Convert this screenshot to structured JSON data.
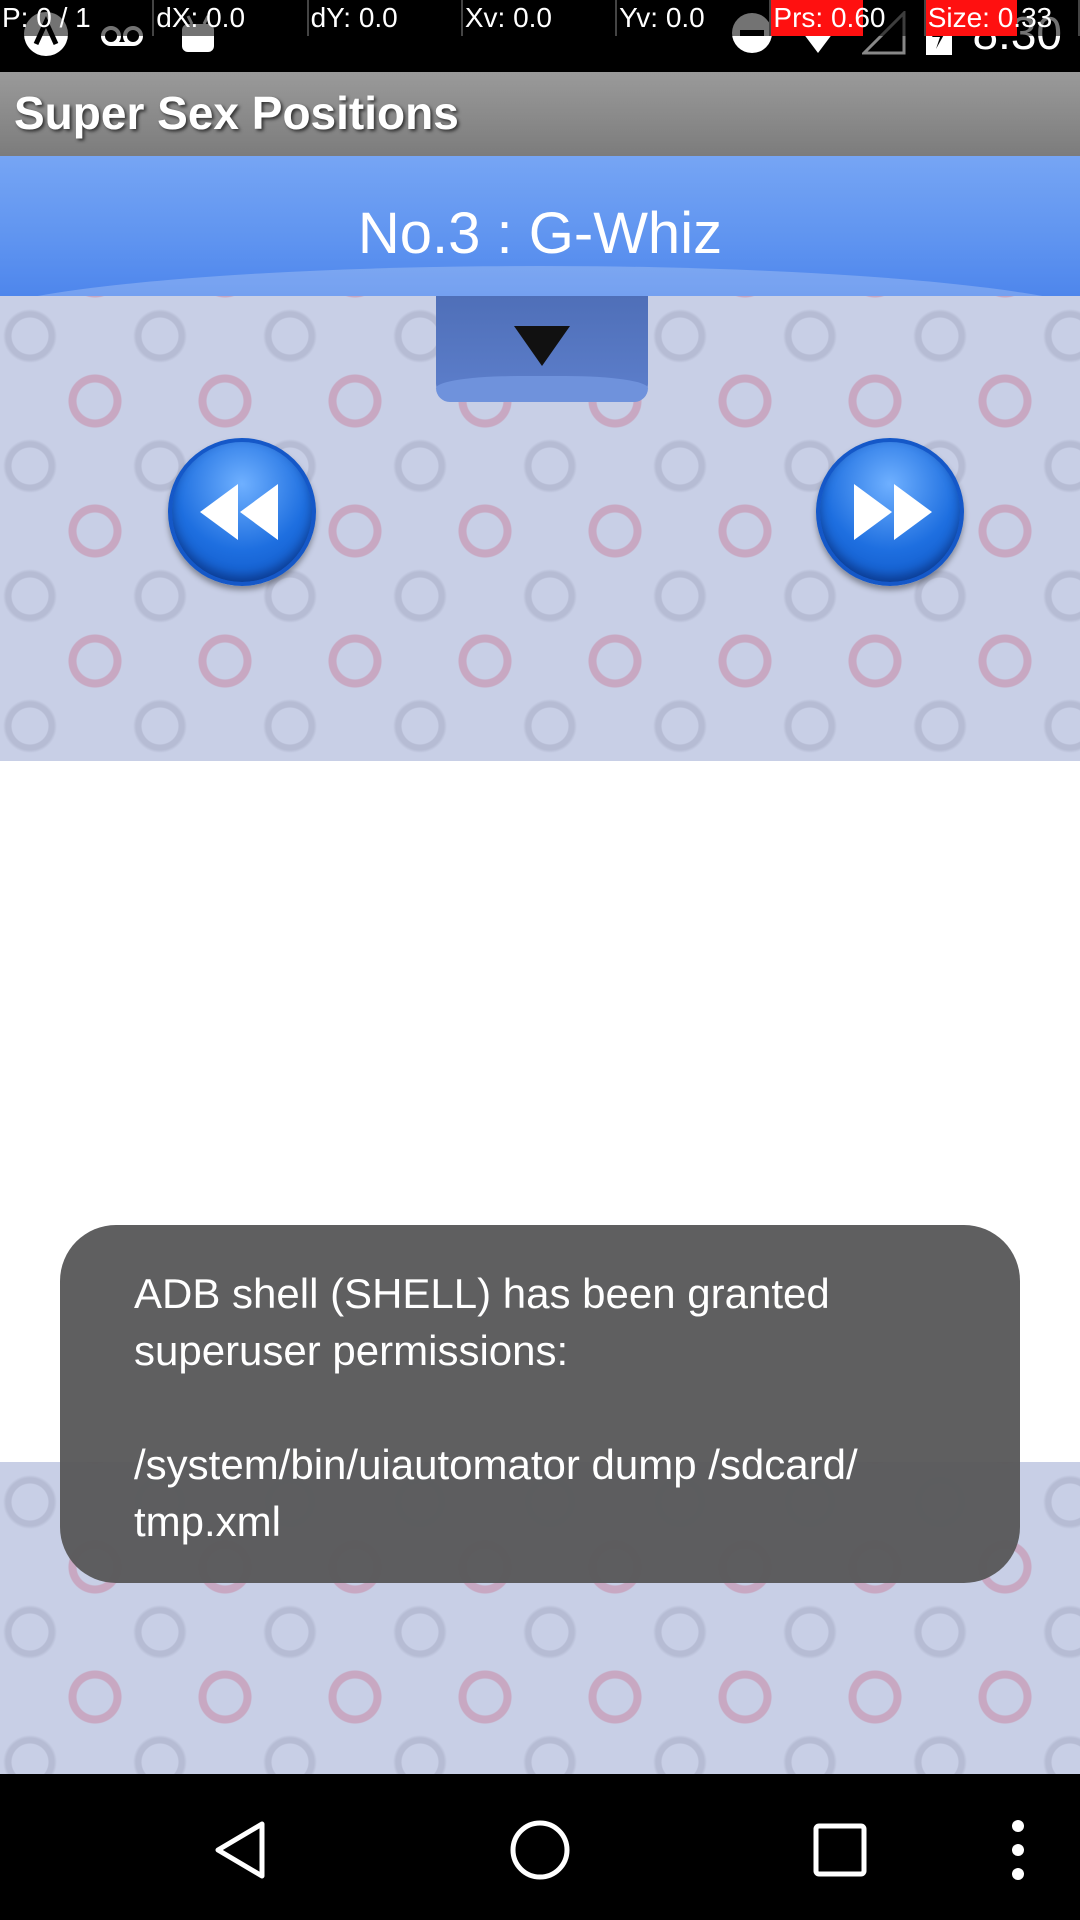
{
  "status_bar": {
    "pointer_overlay": [
      "P: 0 / 1",
      "dX: 0.0",
      "dY: 0.0",
      "Xv: 0.0",
      "Yv: 0.0",
      "Prs: 0.60",
      "Size: 0.33"
    ],
    "time": "8:30",
    "icons_left": [
      "app-icon",
      "voicemail-icon",
      "android-icon"
    ],
    "icons_right": [
      "do-not-disturb-icon",
      "wifi-icon",
      "signal-icon",
      "battery-icon"
    ]
  },
  "action_bar": {
    "title": "Super Sex Positions"
  },
  "banner": {
    "title": "No.3 : G-Whiz"
  },
  "controls": {
    "dropdown_icon": "triangle-down-icon",
    "prev_icon": "rewind-icon",
    "next_icon": "fast-forward-icon"
  },
  "toast": {
    "message": "ADB shell (SHELL) has been granted\nsuperuser permissions:\n\n/system/bin/uiautomator dump /sdcard/\ntmp.xml"
  },
  "nav_bar": {
    "icons": [
      "back-icon",
      "home-icon",
      "recents-icon",
      "overflow-menu-icon"
    ]
  },
  "colors": {
    "banner_blue": "#5f94f0",
    "button_blue": "#1e6fe0",
    "action_bar_gray": "#8a8a8a"
  }
}
